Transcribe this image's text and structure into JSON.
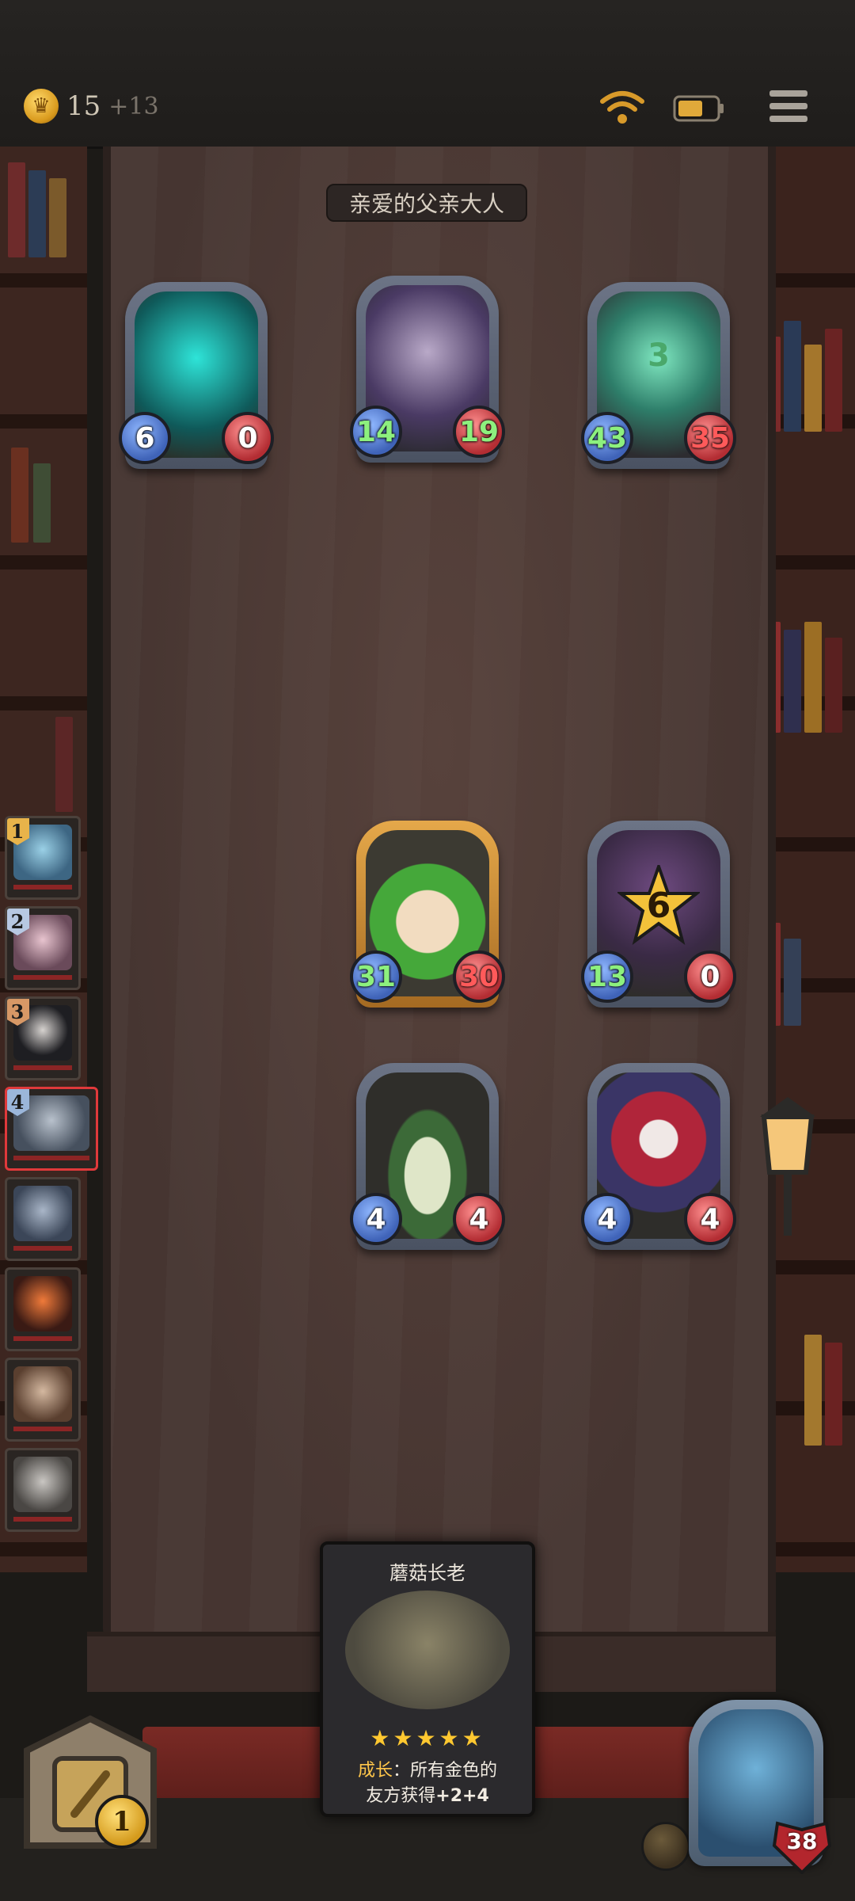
{
  "topbar": {
    "gold": "15",
    "gold_income": "+13"
  },
  "opponent": {
    "name": "亲爱的父亲大人",
    "units": [
      {
        "id": "ghost-warrior",
        "attack": "6",
        "health": "0",
        "attack_color": "normal",
        "health_color": "normal"
      },
      {
        "id": "witch-hunter",
        "attack": "14",
        "health": "19",
        "attack_color": "green",
        "health_color": "green"
      },
      {
        "id": "wisp",
        "attack": "43",
        "health": "35",
        "attack_color": "green",
        "health_color": "red",
        "overlay": "3"
      }
    ]
  },
  "player": {
    "units": [
      {
        "id": "sprout",
        "attack": "31",
        "health": "30",
        "attack_color": "green",
        "health_color": "red",
        "golden": true
      },
      {
        "id": "mushroom",
        "attack": "13",
        "health": "0",
        "attack_color": "green",
        "health_color": "normal",
        "overlay": "6"
      },
      {
        "id": "mandrake",
        "attack": "4",
        "health": "4",
        "attack_color": "normal",
        "health_color": "normal"
      },
      {
        "id": "clown",
        "attack": "4",
        "health": "4",
        "attack_color": "normal",
        "health_color": "normal"
      }
    ]
  },
  "roster": [
    {
      "rank": "1",
      "highlight": false
    },
    {
      "rank": "2",
      "highlight": false
    },
    {
      "rank": "3",
      "highlight": false
    },
    {
      "rank": "4",
      "highlight": true
    },
    {
      "rank": "",
      "highlight": false
    },
    {
      "rank": "",
      "highlight": false
    },
    {
      "rank": "",
      "highlight": false
    },
    {
      "rank": "",
      "highlight": false
    }
  ],
  "card": {
    "title": "蘑菇长老",
    "stars": "★★★★★",
    "keyword": "成长",
    "desc_line1": "：所有金色的",
    "desc_line2": "友方获得",
    "desc_bonus": "+2+4"
  },
  "shop": {
    "level": "1"
  },
  "hero": {
    "health": "38"
  },
  "colors": {
    "attack_green": "#8df07e",
    "health_red": "#ff5a5a",
    "gold": "#ffc830"
  }
}
